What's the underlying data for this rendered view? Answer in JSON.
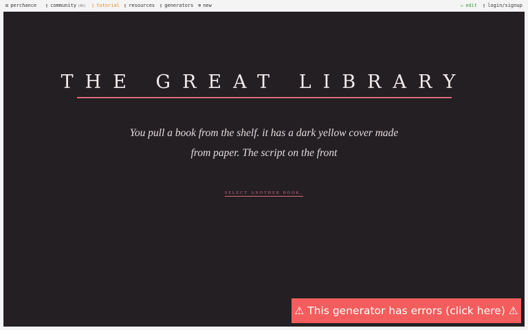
{
  "nav": {
    "items": [
      {
        "icon": "⚄",
        "label": "perchance"
      },
      {
        "icon": "▯",
        "label": "community",
        "badge": "(8h)"
      },
      {
        "icon": "▯",
        "label": "tutorial"
      },
      {
        "icon": "▯",
        "label": "resources"
      },
      {
        "icon": "▯",
        "label": "generators"
      },
      {
        "icon": "⊕",
        "label": "new"
      }
    ],
    "edit": {
      "icon": "✏",
      "label": "edit"
    },
    "login": {
      "icon": "▯",
      "label": "login/signup"
    }
  },
  "main": {
    "title": "THE GREAT LIBRARY",
    "story": "You pull a book from the shelf. it has a dark yellow cover made from paper. The script on the front",
    "select_link": "select another book."
  },
  "error_banner": "⚠ This generator has errors (click here) ⚠",
  "colors": {
    "accent": "#d76c7a",
    "background": "#231f23",
    "error": "#f35d5d",
    "tutorial": "#e08b2b",
    "edit": "#3a9a3a"
  }
}
